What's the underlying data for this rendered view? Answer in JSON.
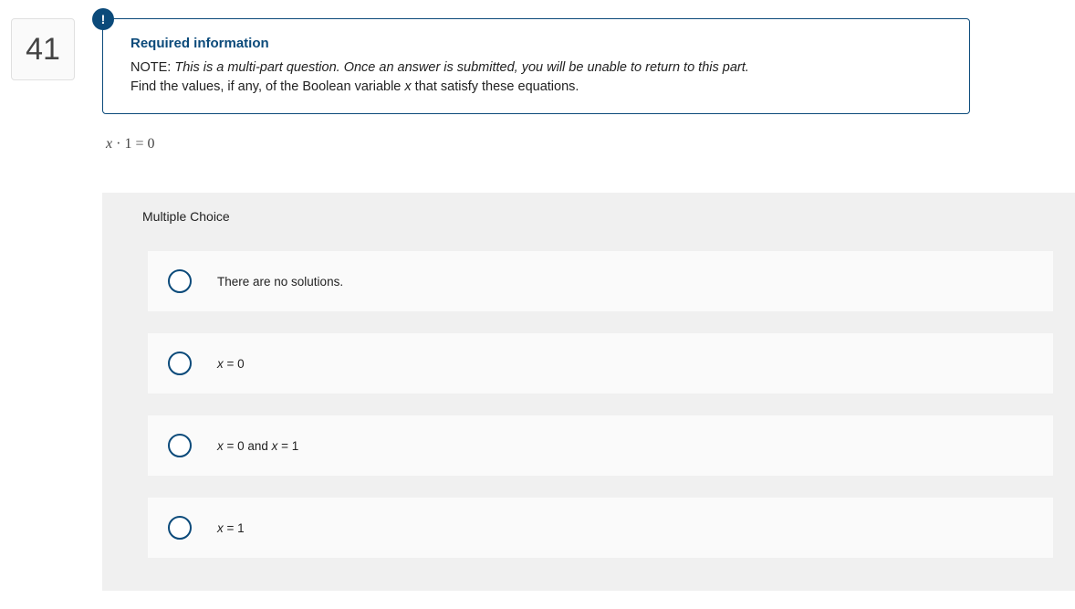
{
  "question_number": "41",
  "alert_symbol": "!",
  "info": {
    "title": "Required information",
    "note_label": "NOTE:",
    "note_italic": "This is a multi-part question. Once an answer is submitted, you will be unable to return to this part.",
    "instruction_pre": "Find the values, if any, of the Boolean variable ",
    "instruction_var": "x",
    "instruction_post": " that satisfy these equations."
  },
  "equation": {
    "var": "x",
    "rest": " · 1 = 0"
  },
  "answers": {
    "header": "Multiple Choice",
    "options": [
      {
        "type": "plain",
        "text": "There are no solutions."
      },
      {
        "type": "eq",
        "var": "x",
        "rest": " = 0"
      },
      {
        "type": "eq2",
        "var1": "x",
        "mid1": " = 0 and ",
        "var2": "x",
        "mid2": " = 1"
      },
      {
        "type": "eq",
        "var": "x",
        "rest": " = 1"
      }
    ]
  }
}
